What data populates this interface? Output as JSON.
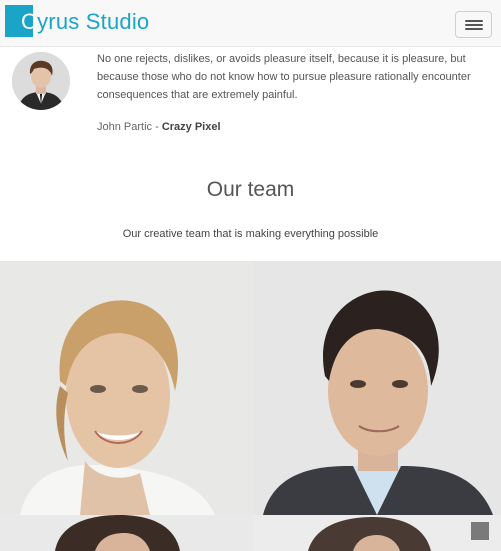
{
  "navbar": {
    "brand_initial": "C",
    "brand_rest": "yrus",
    "brand_second": "Studio",
    "menu_button": "toggle-navigation"
  },
  "testimonial": {
    "quote": "No one rejects, dislikes, or avoids pleasure itself, because it is pleasure, but because those who do not know how to pursue pleasure rationally encounter consequences that are extremely painful.",
    "author_name": "John Partic",
    "separator": " - ",
    "author_company": "Crazy Pixel"
  },
  "team": {
    "title": "Our team",
    "subtitle": "Our creative team that is making everything possible"
  },
  "icons": {
    "menu": "hamburger-icon",
    "back_to_top": "scroll-top-icon"
  },
  "colors": {
    "brand": "#1aa5c8",
    "navbar_bg": "#f8f8f8",
    "text": "#555555"
  }
}
